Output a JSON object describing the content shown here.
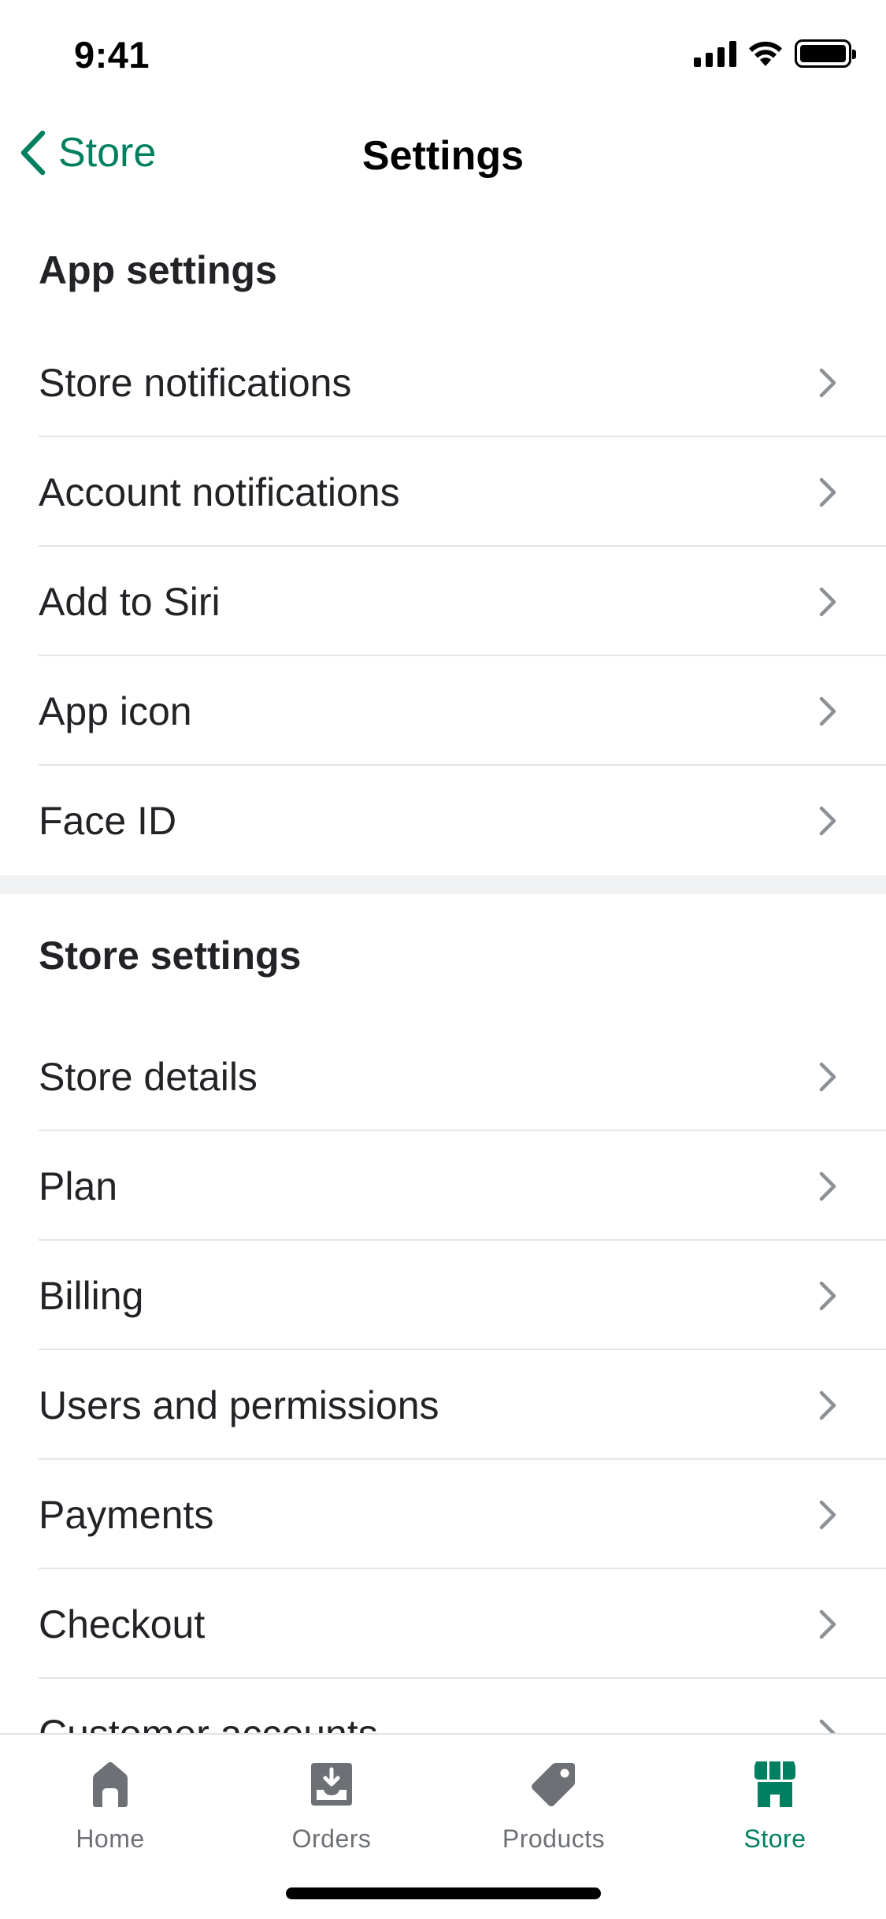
{
  "status_bar": {
    "time": "9:41"
  },
  "nav": {
    "back_label": "Store",
    "title": "Settings"
  },
  "app_settings": {
    "header": "App settings",
    "items": [
      {
        "label": "Store notifications"
      },
      {
        "label": "Account notifications"
      },
      {
        "label": "Add to Siri"
      },
      {
        "label": "App icon"
      },
      {
        "label": "Face ID"
      }
    ]
  },
  "store_settings": {
    "header": "Store settings",
    "items": [
      {
        "label": "Store details"
      },
      {
        "label": "Plan"
      },
      {
        "label": "Billing"
      },
      {
        "label": "Users and permissions"
      },
      {
        "label": "Payments"
      },
      {
        "label": "Checkout"
      },
      {
        "label": "Customer accounts"
      }
    ]
  },
  "tab_bar": {
    "tabs": [
      {
        "label": "Home",
        "icon": "home-icon"
      },
      {
        "label": "Orders",
        "icon": "orders-icon"
      },
      {
        "label": "Products",
        "icon": "tag-icon"
      },
      {
        "label": "Store",
        "icon": "store-icon",
        "active": true
      }
    ]
  },
  "colors": {
    "accent": "#008060",
    "text": "#212326",
    "chevron": "#8c9196",
    "tab_inactive": "#6d7175",
    "divider": "#e4e5e7",
    "section_gap": "#f1f2f4"
  }
}
